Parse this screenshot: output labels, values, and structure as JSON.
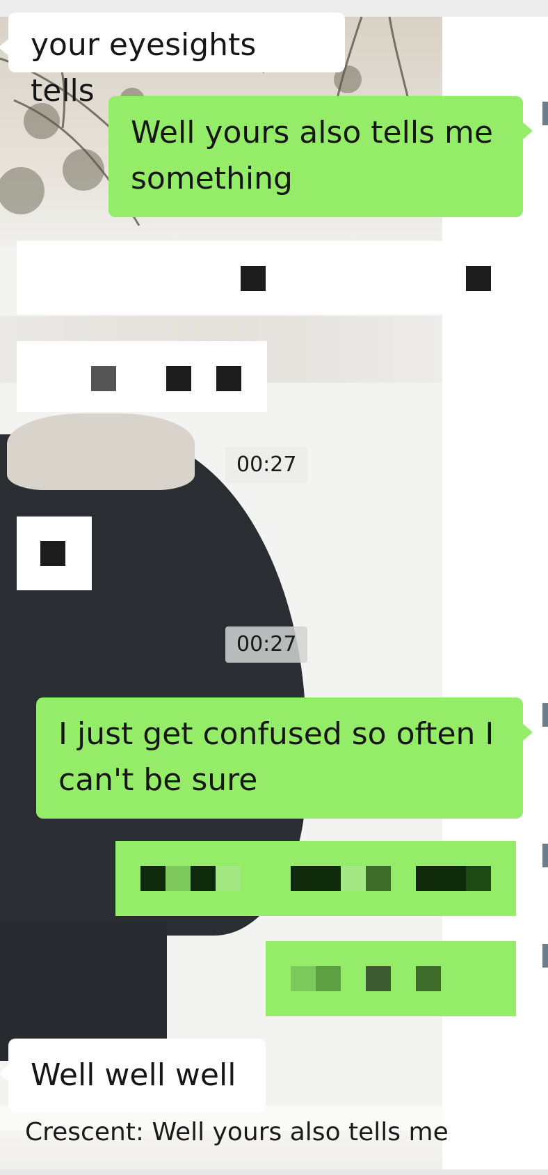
{
  "messages": {
    "m1_text": "your eyesights tells",
    "m2_text": "Well yours also tells me something",
    "m3_text": "I just get confused so often I can't be sure",
    "m4_text": "Well well well"
  },
  "timestamps": {
    "t1": "00:27",
    "t2": "00:27"
  },
  "quote": {
    "sender": "Crescent:",
    "text": "Well yours also tells me"
  },
  "colors": {
    "outgoing_bubble": "#95ec69",
    "incoming_bubble": "#ffffff",
    "redaction": "#1c1c1c"
  }
}
